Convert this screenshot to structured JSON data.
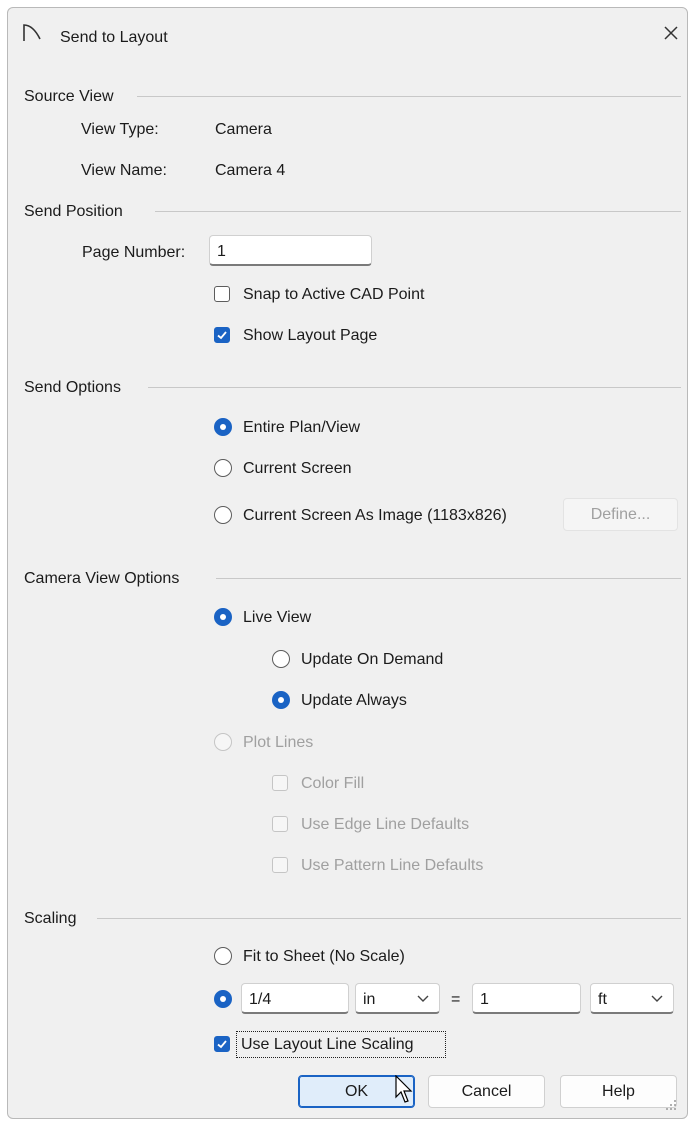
{
  "window": {
    "title": "Send to Layout",
    "close_icon": "close-icon",
    "app_icon": "layout-arc-icon"
  },
  "source_view": {
    "section_label": "Source View",
    "view_type_label": "View Type:",
    "view_type_value": "Camera",
    "view_name_label": "View Name:",
    "view_name_value": "Camera 4"
  },
  "send_position": {
    "section_label": "Send Position",
    "page_number_label": "Page Number:",
    "page_number_value": "1",
    "snap_label": "Snap to Active CAD Point",
    "snap_checked": false,
    "show_layout_label": "Show Layout Page",
    "show_layout_checked": true
  },
  "send_options": {
    "section_label": "Send Options",
    "entire_label": "Entire Plan/View",
    "current_screen_label": "Current Screen",
    "as_image_label": "Current Screen As Image (1183x826)",
    "define_button": "Define...",
    "selected": "Entire Plan/View"
  },
  "camera_view_options": {
    "section_label": "Camera View Options",
    "live_view_label": "Live View",
    "update_demand_label": "Update On Demand",
    "update_always_label": "Update Always",
    "plot_lines_label": "Plot Lines",
    "color_fill_label": "Color Fill",
    "edge_defaults_label": "Use Edge Line Defaults",
    "pattern_defaults_label": "Use Pattern Line Defaults",
    "selected": "Live View",
    "update_selected": "Update Always"
  },
  "scaling": {
    "section_label": "Scaling",
    "fit_label": "Fit to Sheet (No Scale)",
    "scale_value": "1/4",
    "scale_unit": "in",
    "equals": "=",
    "real_value": "1",
    "real_unit": "ft",
    "line_scaling_label": "Use Layout Line Scaling",
    "line_scaling_checked": true,
    "selected": "custom scale"
  },
  "buttons": {
    "ok": "OK",
    "cancel": "Cancel",
    "help": "Help"
  },
  "colors": {
    "accent": "#1a63c4",
    "dialog_bg": "#f0f0f0",
    "disabled_text": "#a0a0a0"
  }
}
